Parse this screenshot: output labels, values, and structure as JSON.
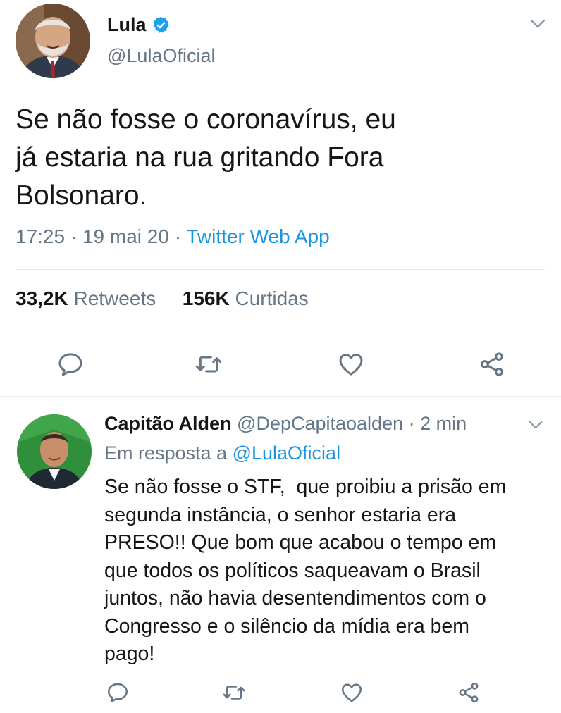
{
  "main_tweet": {
    "display_name": "Lula",
    "handle": "@LulaOficial",
    "text_lines": [
      "Se não fosse o coronavírus, eu",
      "já estaria na rua gritando Fora",
      "Bolsonaro."
    ],
    "time": "17:25",
    "date": "19 mai 20",
    "source": "Twitter Web App",
    "retweets_count": "33,2K",
    "retweets_label": "Retweets",
    "likes_count": "156K",
    "likes_label": "Curtidas",
    "icons": [
      "verified-badge-icon",
      "chevron-down-icon",
      "reply-icon",
      "retweet-icon",
      "like-icon",
      "share-icon"
    ]
  },
  "reply_tweet": {
    "display_name": "Capitão Alden",
    "handle": "@DepCapitaoalden",
    "time_ago": "2 min",
    "in_reply_prefix": "Em resposta a",
    "in_reply_mention": "@LulaOficial",
    "text_lines": [
      "Se não fosse o STF,  que proibiu a prisão em",
      "segunda instância, o senhor estaria era",
      "PRESO!! Que bom que acabou o tempo em",
      "que todos os políticos saqueavam o Brasil",
      "juntos, não havia desentendimentos com o",
      "Congresso e o silêncio da mídia era bem",
      "pago!"
    ]
  },
  "colors": {
    "text_primary": "#14171a",
    "text_secondary": "#657786",
    "link": "#1b95e0",
    "verified": "#1da1f2",
    "divider": "#e1e8ed"
  }
}
